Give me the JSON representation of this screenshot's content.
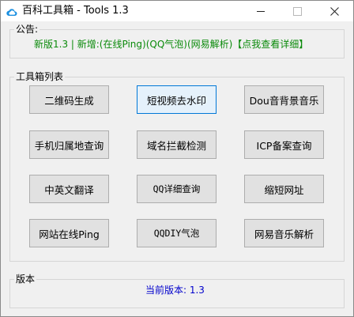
{
  "window": {
    "title": "百科工具箱 - Tools 1.3",
    "icon": "cloud-icon"
  },
  "controls": {
    "minimize": "minimize-icon",
    "maximize": "maximize-icon",
    "close": "close-icon"
  },
  "notice": {
    "label": "公告:",
    "text": "新版1.3 | 新增:(在线Ping)(QQ气泡)(网易解析)【点我查看详细】",
    "color": "#0a8a0a"
  },
  "tools": {
    "label": "工具箱列表",
    "buttons": [
      "二维码生成",
      "短视频去水印",
      "Dou音背景音乐",
      "手机归属地查询",
      "域名拦截检测",
      "ICP备案查询",
      "中英文翻译",
      "QQ详细查询",
      "缩短网址",
      "网站在线Ping",
      "QQDIY气泡",
      "网易音乐解析"
    ]
  },
  "version": {
    "label": "版本",
    "text": "当前版本: 1.3",
    "color": "#0000cc"
  }
}
